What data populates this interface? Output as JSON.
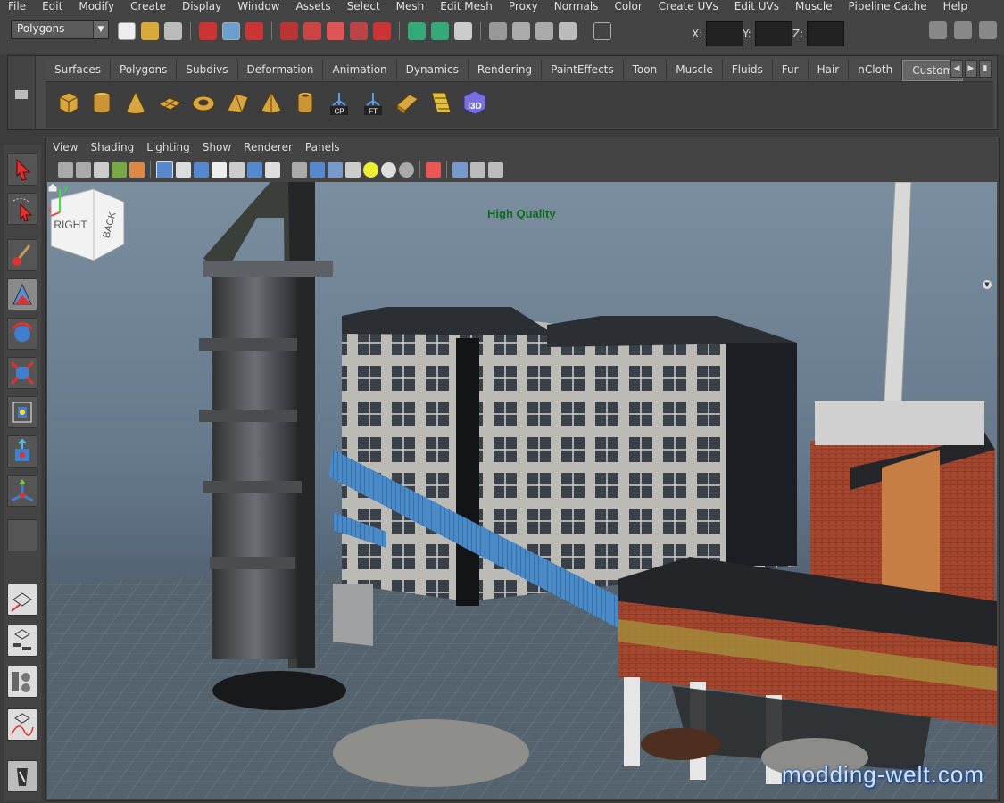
{
  "menu": [
    "File",
    "Edit",
    "Modify",
    "Create",
    "Display",
    "Window",
    "Assets",
    "Select",
    "Mesh",
    "Edit Mesh",
    "Proxy",
    "Normals",
    "Color",
    "Create UVs",
    "Edit UVs",
    "Muscle",
    "Pipeline Cache",
    "Help"
  ],
  "status_line": {
    "mode": "Polygons",
    "x_label": "X:",
    "y_label": "Y:",
    "z_label": "Z:"
  },
  "shelf": {
    "tabs": [
      "Surfaces",
      "Polygons",
      "Subdivs",
      "Deformation",
      "Animation",
      "Dynamics",
      "Rendering",
      "PaintEffects",
      "Toon",
      "Muscle",
      "Fluids",
      "Fur",
      "Hair",
      "nCloth",
      "Custom"
    ],
    "active_tab": "Custom",
    "icons": [
      "cube-icon",
      "cylinder-icon",
      "cone-icon",
      "plane-icon",
      "torus-icon",
      "prism-icon",
      "pyramid-icon",
      "pipe-icon",
      "center-pivot-icon",
      "freeze-transform-icon",
      "bevel-icon",
      "uv-icon",
      "i3d-icon"
    ],
    "cp_label": "CP",
    "ft_label": "FT",
    "i3d_label": "i3D"
  },
  "panel_menu": [
    "View",
    "Shading",
    "Lighting",
    "Show",
    "Renderer",
    "Panels"
  ],
  "viewport": {
    "quality_label": "High Quality",
    "viewcube_right": "RIGHT",
    "viewcube_back": "BACK",
    "watermark": "modding-welt.com",
    "axis_y": "y",
    "axis_x": "x"
  },
  "colors": {
    "accent_tab": "#666666",
    "hq_text": "#0d6b1e",
    "watermark": "#cfe6ff"
  }
}
